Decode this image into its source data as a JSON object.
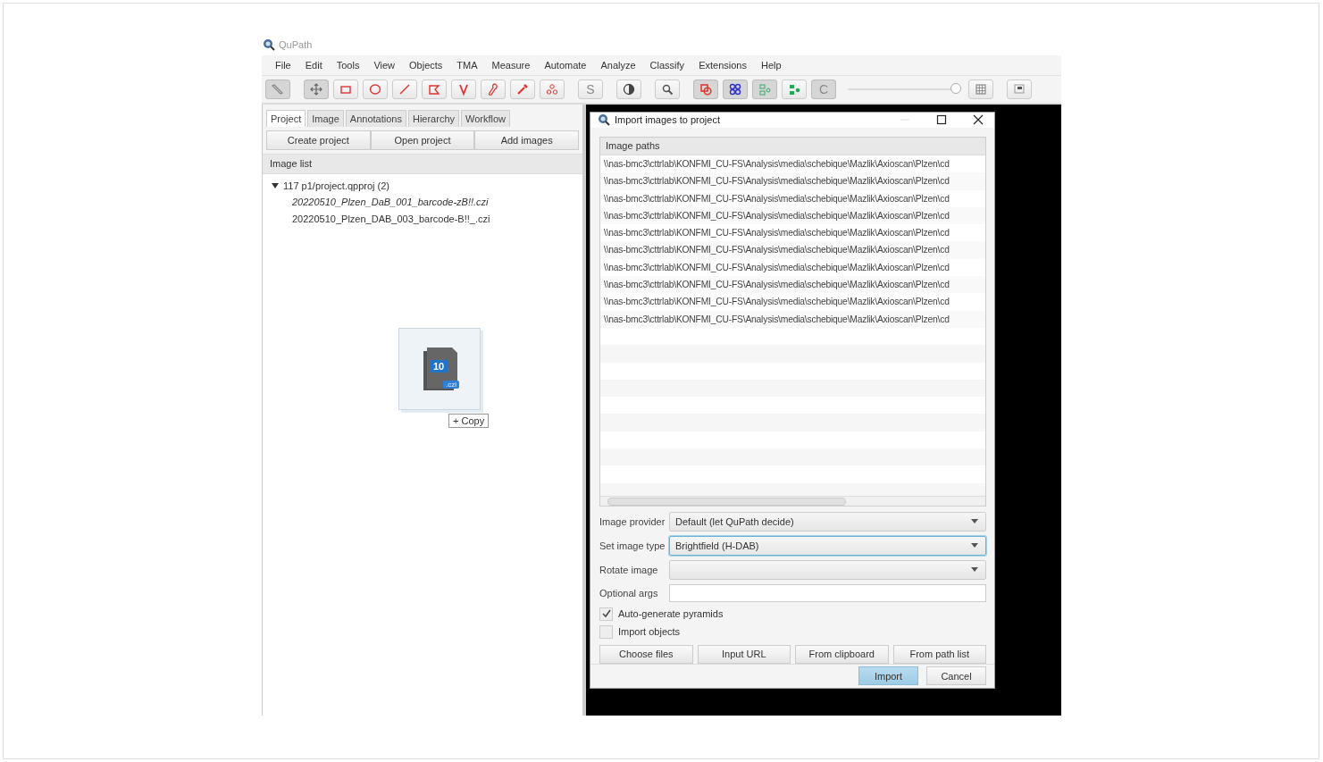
{
  "window": {
    "title": "QuPath"
  },
  "menu": [
    "File",
    "Edit",
    "Tools",
    "View",
    "Objects",
    "TMA",
    "Measure",
    "Automate",
    "Analyze",
    "Classify",
    "Extensions",
    "Help"
  ],
  "toolbar": [
    [
      {
        "kind": "pen",
        "selected": true
      }
    ],
    [
      {
        "kind": "move",
        "selected": true
      },
      {
        "kind": "rect",
        "selected": false
      },
      {
        "kind": "ellipse",
        "selected": false
      },
      {
        "kind": "line",
        "selected": false
      },
      {
        "kind": "polygon",
        "selected": false
      },
      {
        "kind": "polyline",
        "selected": false
      },
      {
        "kind": "brush",
        "selected": false
      },
      {
        "kind": "wand",
        "selected": false
      },
      {
        "kind": "points",
        "selected": false
      }
    ],
    [
      {
        "kind": "letter",
        "label": "S",
        "selected": false
      }
    ],
    [
      {
        "kind": "contrast",
        "selected": false
      }
    ],
    [
      {
        "kind": "zoom",
        "selected": false
      }
    ],
    [
      {
        "kind": "overlap",
        "selected": true
      },
      {
        "kind": "cells",
        "selected": true
      },
      {
        "kind": "tree",
        "selected": true
      },
      {
        "kind": "tree-filled",
        "selected": false
      },
      {
        "kind": "letter",
        "label": "C",
        "selected": true
      },
      {
        "kind": "slider",
        "level": 1
      },
      {
        "kind": "grid",
        "selected": false
      }
    ],
    [
      {
        "kind": "overview",
        "selected": false
      }
    ]
  ],
  "left_panel": {
    "tabs": [
      {
        "label": "Project",
        "selected": true
      },
      {
        "label": "Image",
        "selected": false
      },
      {
        "label": "Annotations",
        "selected": false
      },
      {
        "label": "Hierarchy",
        "selected": false
      },
      {
        "label": "Workflow",
        "selected": false
      }
    ],
    "buttons": [
      "Create project",
      "Open project",
      "Add images"
    ],
    "list_title": "Image list",
    "tree": [
      {
        "label": "117 p1/project.qpproj (2)",
        "expanded": true,
        "children": [
          {
            "label": "20220510_Plzen_DaB_001_barcode-zB!!.czi",
            "italic": true
          },
          {
            "label": "20220510_Plzen_DAB_003_barcode-B!!_.czi",
            "italic": false
          }
        ]
      }
    ],
    "drag": {
      "count": "10",
      "extension": ".czi",
      "action": "+ Copy"
    }
  },
  "dialog": {
    "title": "Import images to project",
    "table": {
      "column": "Image paths",
      "rows": [
        "\\\\nas-bmc3\\cttrlab\\KONFMI_CU-FS\\Analysis\\media\\schebique\\Mazlik\\Axioscan\\Plzen\\cd",
        "\\\\nas-bmc3\\cttrlab\\KONFMI_CU-FS\\Analysis\\media\\schebique\\Mazlik\\Axioscan\\Plzen\\cd",
        "\\\\nas-bmc3\\cttrlab\\KONFMI_CU-FS\\Analysis\\media\\schebique\\Mazlik\\Axioscan\\Plzen\\cd",
        "\\\\nas-bmc3\\cttrlab\\KONFMI_CU-FS\\Analysis\\media\\schebique\\Mazlik\\Axioscan\\Plzen\\cd",
        "\\\\nas-bmc3\\cttrlab\\KONFMI_CU-FS\\Analysis\\media\\schebique\\Mazlik\\Axioscan\\Plzen\\cd",
        "\\\\nas-bmc3\\cttrlab\\KONFMI_CU-FS\\Analysis\\media\\schebique\\Mazlik\\Axioscan\\Plzen\\cd",
        "\\\\nas-bmc3\\cttrlab\\KONFMI_CU-FS\\Analysis\\media\\schebique\\Mazlik\\Axioscan\\Plzen\\cd",
        "\\\\nas-bmc3\\cttrlab\\KONFMI_CU-FS\\Analysis\\media\\schebique\\Mazlik\\Axioscan\\Plzen\\cd",
        "\\\\nas-bmc3\\cttrlab\\KONFMI_CU-FS\\Analysis\\media\\schebique\\Mazlik\\Axioscan\\Plzen\\cd",
        "\\\\nas-bmc3\\cttrlab\\KONFMI_CU-FS\\Analysis\\media\\schebique\\Mazlik\\Axioscan\\Plzen\\cd"
      ]
    },
    "fields": [
      {
        "label": "Image provider",
        "kind": "dropdown",
        "value": "Default (let QuPath decide)",
        "focused": false
      },
      {
        "label": "Set image type",
        "kind": "dropdown",
        "value": "Brightfield (H-DAB)",
        "focused": true
      },
      {
        "label": "Rotate image",
        "kind": "dropdown",
        "focused": false
      },
      {
        "label": "Optional args",
        "kind": "text",
        "focused": false
      }
    ],
    "checkboxes": [
      {
        "label": "Auto-generate pyramids",
        "checked": true
      },
      {
        "label": "Import objects",
        "checked": false
      }
    ],
    "source_buttons": [
      "Choose files",
      "Input URL",
      "From clipboard",
      "From path list"
    ],
    "footer_buttons": [
      {
        "label": "Import",
        "default": true
      },
      {
        "label": "Cancel",
        "default": false
      }
    ]
  }
}
